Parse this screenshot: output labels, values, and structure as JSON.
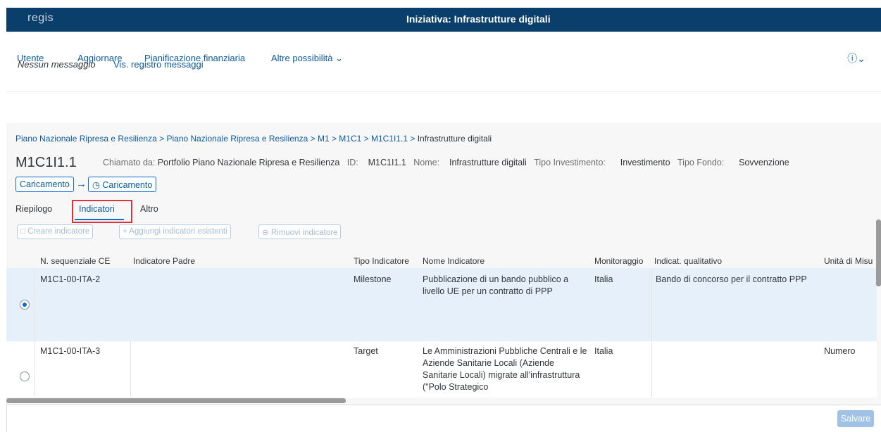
{
  "header": {
    "logo": "regis",
    "title": "Iniziativa: Infrastrutture digitali"
  },
  "menu": {
    "items": [
      "Utente",
      "Aggiornare",
      "Pianificazione finanziaria",
      "Altre possibilità"
    ],
    "help_icon": "help-icon"
  },
  "messages": {
    "none": "Nessun messaggio",
    "log_link": "Vis. registro messaggi"
  },
  "breadcrumb": {
    "links": [
      "Piano Nazionale Ripresa e Resilienza",
      "Piano Nazionale Ripresa e Resilienza",
      "M1",
      "M1C1",
      "M1C1I1.1"
    ],
    "current": "Infrastrutture digitali",
    "separator": " > "
  },
  "object": {
    "title": "M1C1I1.1",
    "called_by_label": "Chiamato da:",
    "called_by_value": "Portfolio Piano Nazionale Ripresa e Resilienza",
    "id_label": "ID:",
    "id_value": "M1C1I1.1",
    "name_label": "Nome:",
    "name_value": "Infrastrutture digitali",
    "inv_type_label": "Tipo Investimento:",
    "inv_type_value": "Investimento",
    "fund_type_label": "Tipo Fondo:",
    "fund_type_value": "Sovvenzione",
    "status_from": "Caricamento",
    "status_to": "Caricamento"
  },
  "tabs": [
    "Riepilogo",
    "Indicatori",
    "Altro"
  ],
  "toolbar": {
    "create": "Creare indicatore",
    "add_existing": "Aggiungi indicatori esistenti",
    "remove": "Rimuovi indicatore"
  },
  "table": {
    "headers": [
      "N. sequenziale CE",
      "Indicatore Padre",
      "Tipo Indicatore",
      "Nome Indicatore",
      "Monitoraggio",
      "Indicat. qualitativo",
      "Unità di Misu"
    ],
    "rows": [
      {
        "seq": "M1C1-00-ITA-2",
        "parent": "",
        "type": "Milestone",
        "name": "Pubblicazione di un bando pubblico a livello UE per un contratto di PPP",
        "monitoring": "Italia",
        "qualitative": "Bando di concorso per il contratto PPP",
        "unit": "",
        "selected": true
      },
      {
        "seq": "M1C1-00-ITA-3",
        "parent": "",
        "type": "Target",
        "name": "Le Amministrazioni Pubbliche Centrali e le Aziende Sanitarie Locali (Aziende Sanitarie Locali) migrate all'infrastruttura (\"Polo Strategico",
        "monitoring": "Italia",
        "qualitative": "",
        "unit": "Numero",
        "selected": false
      }
    ]
  },
  "footer": {
    "save": "Salvare"
  },
  "colors": {
    "shell": "#0a3e6b",
    "link": "#0a5a9c",
    "accent": "#0a6ed1",
    "selected_row": "#e5f0fa",
    "highlight": "#e3303a"
  }
}
